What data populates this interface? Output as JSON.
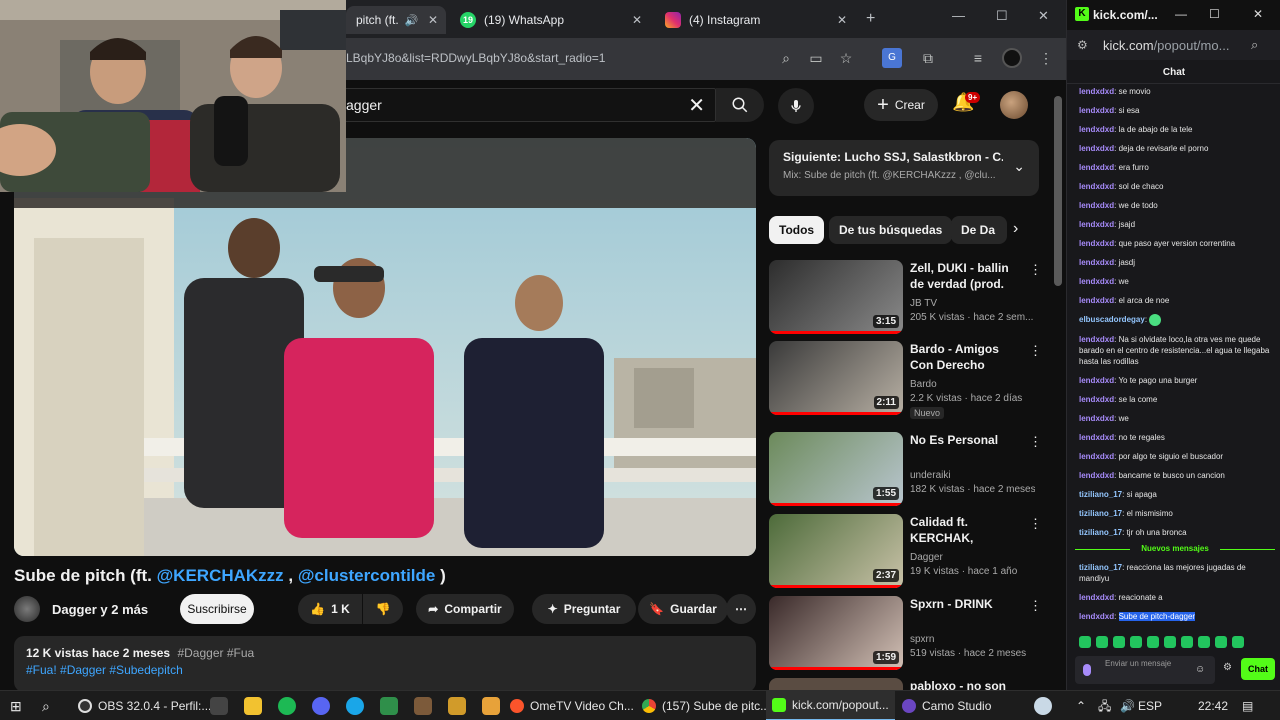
{
  "browser": {
    "tabs": [
      {
        "title": "pitch (ft.",
        "close": "✕"
      },
      {
        "title": "(19) WhatsApp",
        "badge": "19",
        "close": "✕"
      },
      {
        "title": "(4) Instagram",
        "close": "✕"
      }
    ],
    "new_tab": "+",
    "url": "LBqbYJ8o&list=RDDwyLBqbYJ8o&start_radio=1"
  },
  "youtube": {
    "search_value": "agger",
    "create_label": "Crear",
    "notification_badge": "9+",
    "video": {
      "title_prefix": "Sube de pitch (ft. ",
      "mention1": "@KERCHAKzzz",
      "sep": " , ",
      "mention2": "@clustercontilde",
      "title_suffix": " )",
      "channel": "Dagger y 2 más",
      "subscribe": "Suscribirse",
      "likes": "1 K",
      "share": "Compartir",
      "ask": "Preguntar",
      "save": "Guardar",
      "stats": "12 K vistas  hace 2 meses",
      "stats_tags": "#Dagger #Fua",
      "hashtags": "#Fua! #Dagger #Subedepitch"
    },
    "up_next": {
      "title": "Siguiente: Lucho SSJ, Salastkbron - C...",
      "subtitle": "Mix: Sube de pitch (ft. @KERCHAKzzz , @clu..."
    },
    "chips": [
      "Todos",
      "De tus búsquedas",
      "De Da"
    ],
    "recommendations": [
      {
        "title": "Zell, DUKI - ballin de verdad (prod. ezeq)",
        "channel": "JB TV",
        "meta": "205 K vistas · hace 2 sem...",
        "duration": "3:15"
      },
      {
        "title": "Bardo - Amigos Con Derecho (Video ...",
        "channel": "Bardo",
        "meta": "2.2 K vistas · hace 2 días",
        "duration": "2:11",
        "badge": "Nuevo"
      },
      {
        "title": "No Es Personal",
        "channel": "underaiki",
        "meta": "182 K vistas · hace 2 meses",
        "duration": "1:55"
      },
      {
        "title": "Calidad ft. KERCHAK, Clúster...",
        "channel": "Dagger",
        "meta": "19 K vistas · hace 1 año",
        "duration": "2:37"
      },
      {
        "title": "Spxrn - DRINK",
        "channel": "spxrn",
        "meta": "519 vistas · hace 2 meses",
        "duration": "1:59"
      },
      {
        "title": "pabloxo - no son",
        "channel": "",
        "meta": "",
        "duration": ""
      }
    ]
  },
  "kick": {
    "window_title": "kick.com/...",
    "url_host": "kick.com",
    "url_path": "/popout/mo...",
    "chat_header": "Chat",
    "messages": [
      {
        "user": "lendxdxd",
        "text": "se movio"
      },
      {
        "user": "lendxdxd",
        "text": "si esa"
      },
      {
        "user": "lendxdxd",
        "text": "la de abajo de la tele"
      },
      {
        "user": "lendxdxd",
        "text": "deja de revisarle el porno"
      },
      {
        "user": "lendxdxd",
        "text": "era furro"
      },
      {
        "user": "lendxdxd",
        "text": "sol de chaco"
      },
      {
        "user": "lendxdxd",
        "text": "we de todo"
      },
      {
        "user": "lendxdxd",
        "text": "jsajd"
      },
      {
        "user": "lendxdxd",
        "text": "que paso ayer version correntina"
      },
      {
        "user": "lendxdxd",
        "text": "jasdj"
      },
      {
        "user": "lendxdxd",
        "text": "we"
      },
      {
        "user": "lendxdxd",
        "text": "el arca de noe"
      },
      {
        "user": "elbuscadordegay",
        "text": "",
        "emote": true
      },
      {
        "user": "lendxdxd",
        "text": "Na si olvidate loco,la otra ves me quede barado en el centro de resistencia...el agua te llegaba hasta las rodillas"
      },
      {
        "user": "lendxdxd",
        "text": "Yo te pago una burger"
      },
      {
        "user": "lendxdxd",
        "text": "se la come"
      },
      {
        "user": "lendxdxd",
        "text": "we"
      },
      {
        "user": "lendxdxd",
        "text": "no te regales"
      },
      {
        "user": "lendxdxd",
        "text": "por algo te siguio el buscador"
      },
      {
        "user": "lendxdxd",
        "text": "bancame te busco un cancion"
      },
      {
        "user": "tiziliano_17",
        "text": "si apaga"
      },
      {
        "user": "tiziliano_17",
        "text": "el mismisimo"
      },
      {
        "user": "tiziliano_17",
        "text": "tjr oh una bronca"
      }
    ],
    "new_messages_label": "Nuevos mensajes",
    "new_messages": [
      {
        "user": "tiziliano_17",
        "text": "reacciona las mejores jugadas de mandiyu"
      },
      {
        "user": "lendxdxd",
        "text": "reacionate a"
      },
      {
        "user": "lendxdxd",
        "text": "Sube de pitch-dagger",
        "highlight": true
      }
    ],
    "input_placeholder": "Enviar un mensaje",
    "send_label": "Chat"
  },
  "taskbar": {
    "apps": [
      {
        "label": "OBS 32.0.4 - Perfil:..."
      },
      {
        "label": "OmeTV Video Ch..."
      },
      {
        "label": "(157) Sube de pitc..."
      },
      {
        "label": "kick.com/popout..."
      },
      {
        "label": "Camo Studio"
      }
    ],
    "lang": "ESP",
    "time": "22:42"
  }
}
